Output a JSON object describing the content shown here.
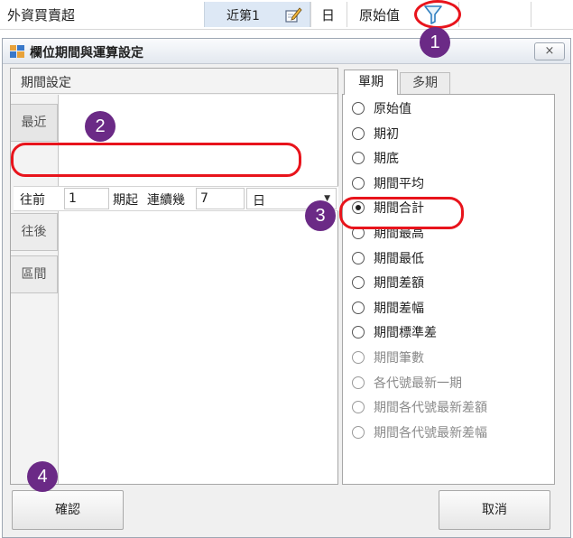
{
  "topbar": {
    "field_name": "外資買賣超",
    "period_text": "近第1",
    "unit_text": "日",
    "calc_text": "原始值",
    "edit_icon": "edit-pencil-icon",
    "filter_icon": "funnel-filter-icon"
  },
  "dialog": {
    "title": "欄位期間與運算設定",
    "title_icon": "window-grid-icon",
    "close_label": "×",
    "left_panel": {
      "header": "期間設定",
      "vertical_tabs": [
        "最近",
        "往後",
        "區間"
      ],
      "period_row": {
        "label_before": "往前",
        "offset_value": "1",
        "label_start": "期起",
        "label_consecutive": "連續幾",
        "count_value": "7",
        "unit_value": "日"
      }
    },
    "right_panel": {
      "tabs": [
        "單期",
        "多期"
      ],
      "active_tab": "單期",
      "options": [
        {
          "label": "原始值",
          "selected": false,
          "enabled": true
        },
        {
          "label": "期初",
          "selected": false,
          "enabled": true
        },
        {
          "label": "期底",
          "selected": false,
          "enabled": true
        },
        {
          "label": "期間平均",
          "selected": false,
          "enabled": true
        },
        {
          "label": "期間合計",
          "selected": true,
          "enabled": true
        },
        {
          "label": "期間最高",
          "selected": false,
          "enabled": true
        },
        {
          "label": "期間最低",
          "selected": false,
          "enabled": true
        },
        {
          "label": "期間差額",
          "selected": false,
          "enabled": true
        },
        {
          "label": "期間差幅",
          "selected": false,
          "enabled": true
        },
        {
          "label": "期間標準差",
          "selected": false,
          "enabled": true
        },
        {
          "label": "期間筆數",
          "selected": false,
          "enabled": false
        },
        {
          "label": "各代號最新一期",
          "selected": false,
          "enabled": false
        },
        {
          "label": "期間各代號最新差額",
          "selected": false,
          "enabled": false
        },
        {
          "label": "期間各代號最新差幅",
          "selected": false,
          "enabled": false
        }
      ]
    },
    "buttons": {
      "confirm": "確認",
      "cancel": "取消"
    }
  },
  "annotations": {
    "steps": [
      "1",
      "2",
      "3",
      "4"
    ],
    "highlight_color": "#e8141c",
    "badge_color": "#6b2a86"
  }
}
